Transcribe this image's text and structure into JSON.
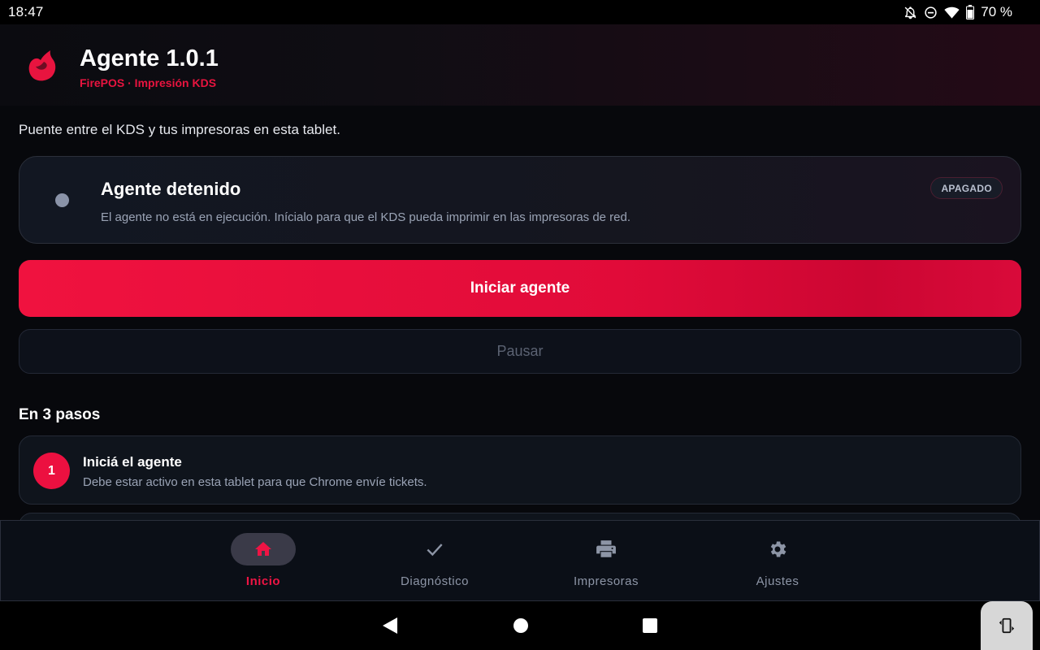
{
  "status_bar": {
    "time": "18:47",
    "battery": "70 %",
    "icons": [
      "notifications-off-icon",
      "do-not-disturb-icon",
      "wifi-icon",
      "battery-icon"
    ]
  },
  "header": {
    "title": "Agente 1.0.1",
    "subtitle": "FirePOS · Impresión KDS",
    "logo_icon": "flame-logo-icon"
  },
  "intro_text": "Puente entre el KDS y tus impresoras en esta tablet.",
  "status_card": {
    "title": "Agente detenido",
    "description": "El agente no está en ejecución. Inícialo para que el KDS pueda imprimir en las impresoras de red.",
    "badge": "APAGADO"
  },
  "actions": {
    "start_label": "Iniciar agente",
    "pause_label": "Pausar"
  },
  "steps_section": {
    "title": "En 3 pasos",
    "steps": [
      {
        "number": "1",
        "title": "Iniciá el agente",
        "description": "Debe estar activo en esta tablet para que Chrome envíe tickets."
      }
    ]
  },
  "bottom_nav": {
    "items": [
      {
        "label": "Inicio",
        "icon": "home-icon",
        "active": true
      },
      {
        "label": "Diagnóstico",
        "icon": "check-icon",
        "active": false
      },
      {
        "label": "Impresoras",
        "icon": "printer-icon",
        "active": false
      },
      {
        "label": "Ajustes",
        "icon": "gear-icon",
        "active": false
      }
    ]
  },
  "colors": {
    "accent": "#ec1040",
    "background": "#07080c",
    "card": "#121722",
    "muted_text": "#9aa3b5"
  }
}
